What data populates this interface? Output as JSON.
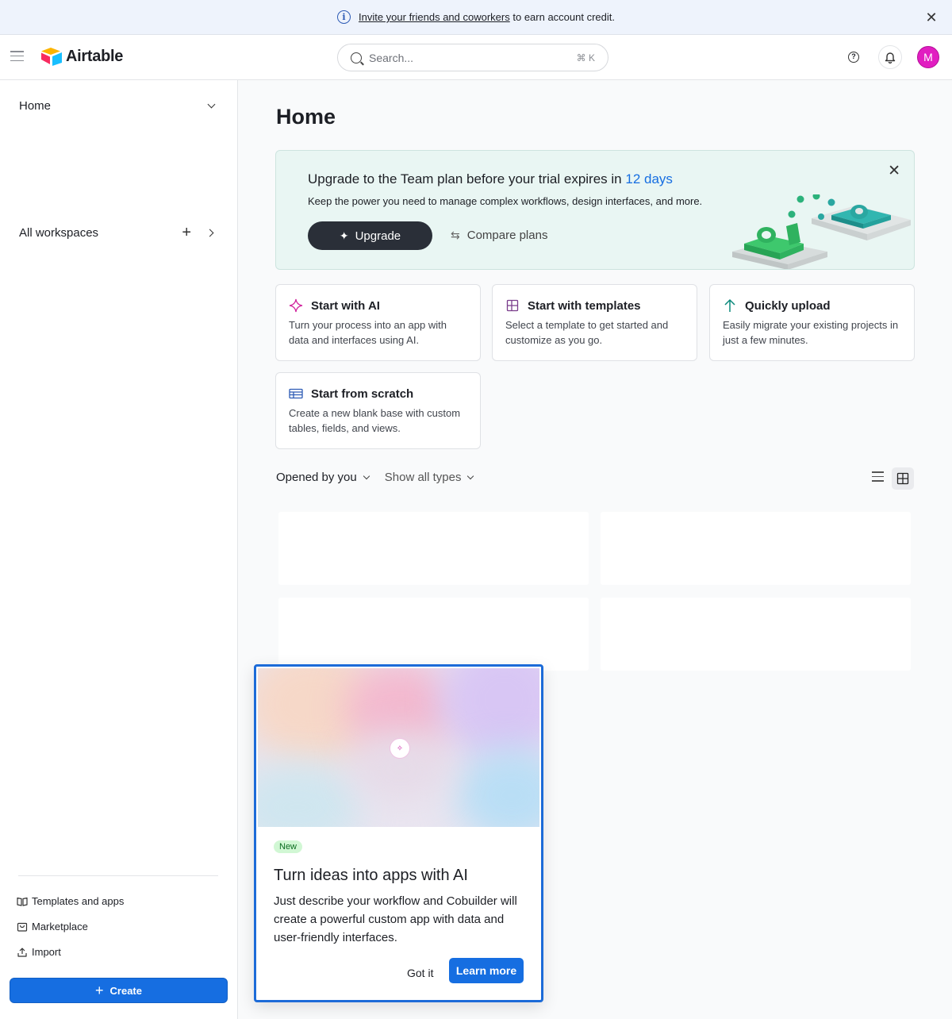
{
  "banner": {
    "link_text": "Invite your friends and coworkers",
    "suffix_text": " to earn account credit."
  },
  "header": {
    "brand": "Airtable",
    "search_placeholder": "Search...",
    "search_shortcut": "⌘ K",
    "help_icon": "question-circle-icon",
    "bell_icon": "bell-icon",
    "avatar_initial": "M",
    "avatar_color": "#e11ec1"
  },
  "sidebar": {
    "home_label": "Home",
    "workspaces_label": "All workspaces",
    "links": [
      {
        "label": "Templates and apps",
        "icon": "book-icon"
      },
      {
        "label": "Marketplace",
        "icon": "shop-icon"
      },
      {
        "label": "Import",
        "icon": "upload-icon"
      }
    ],
    "create_label": "Create",
    "create_color": "#166ee1"
  },
  "main": {
    "title": "Home",
    "upgrade": {
      "title_prefix": "Upgrade to the Team plan before your trial expires in ",
      "days": "12 days",
      "subtitle": "Keep the power you need to manage complex workflows, design interfaces, and more.",
      "upgrade_label": "Upgrade",
      "compare_label": "Compare plans"
    },
    "start_cards": [
      {
        "title": "Start with AI",
        "desc": "Turn your process into an app with data and interfaces using AI.",
        "icon": "sparkle-icon"
      },
      {
        "title": "Start with templates",
        "desc": "Select a template to get started and customize as you go.",
        "icon": "grid-icon"
      },
      {
        "title": "Quickly upload",
        "desc": "Easily migrate your existing projects in just a few minutes.",
        "icon": "arrow-up-icon"
      },
      {
        "title": "Start from scratch",
        "desc": "Create a new blank base with custom tables, fields, and views.",
        "icon": "table-icon"
      }
    ],
    "filters": {
      "opened_by": "Opened by you",
      "types": "Show all types"
    }
  },
  "popover": {
    "badge": "New",
    "title": "Turn ideas into apps with AI",
    "body": "Just describe your workflow and Cobuilder will create a powerful custom app with data and user-friendly interfaces.",
    "dismiss_label": "Got it",
    "learn_label": "Learn more"
  }
}
